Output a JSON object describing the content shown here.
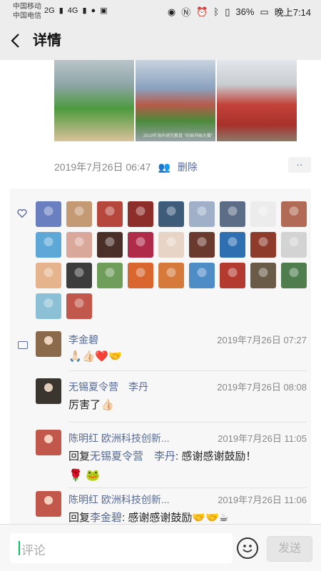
{
  "statusbar": {
    "carrier1": "中国移动",
    "carrier2": "中国电信",
    "net1": "2G",
    "net2": "4G",
    "battery": "36%",
    "time": "晚上7:14"
  },
  "navbar": {
    "back_icon": "chevron-left",
    "title": "详情"
  },
  "post": {
    "photo_captions": [
      "",
      "2019年海外研究教育 \"中国书画大赛\"",
      ""
    ],
    "timestamp": "2019年7月26日 06:47",
    "delete_label": "删除",
    "more_label": "··"
  },
  "likes": {
    "icon": "heart-outline-icon",
    "avatar_colors": [
      "#6a7fc0",
      "#c39a73",
      "#b5473c",
      "#8d2e2a",
      "#3e5c7a",
      "#9fb0c8",
      "#5c6e87",
      "#ececec",
      "#b06a55",
      "#5ea8d8",
      "#d9a89a",
      "#4a2e28",
      "#b02a4a",
      "#e7d4c7",
      "#6b3a2e",
      "#2d6fb0",
      "#8f3b2b",
      "#d3d3d3",
      "#e6b48c",
      "#3c3c3c",
      "#6f9d5a",
      "#d8662e",
      "#d57a3a",
      "#4e8cc6",
      "#b33a2e",
      "#6a5a48",
      "#4f7d4e",
      "#8cc0d6",
      "#c2574c"
    ]
  },
  "comments": [
    {
      "name": "李金碧",
      "time": "2019年7月26日 07:27",
      "text": "",
      "reply_to": "",
      "reply_prefix": "",
      "emoji": "🙏🏻👍🏻❤️🤝",
      "avatar_color": "#8a6a4a"
    },
    {
      "name": "无锡夏令营　李丹",
      "time": "2019年7月26日 08:08",
      "text": "厉害了👍🏻",
      "reply_to": "",
      "reply_prefix": "",
      "emoji": "",
      "avatar_color": "#3b3530"
    },
    {
      "name": "陈明红 欧洲科技创新...",
      "time": "2019年7月26日 11:05",
      "text": ": 感谢感谢鼓励！",
      "reply_to": "无锡夏令营　李丹",
      "reply_prefix": "回复",
      "emoji": "🌹 🐸",
      "avatar_color": "#c2574c"
    },
    {
      "name": "陈明红 欧洲科技创新...",
      "time": "2019年7月26日 11:06",
      "text": ": 感谢感谢鼓励🤝🤝☕",
      "reply_to": "李金碧",
      "reply_prefix": "回复",
      "emoji": "",
      "avatar_color": "#c2574c"
    }
  ],
  "input": {
    "placeholder": "评论",
    "emoji_icon": "smile-face-icon",
    "send_label": "发送"
  }
}
